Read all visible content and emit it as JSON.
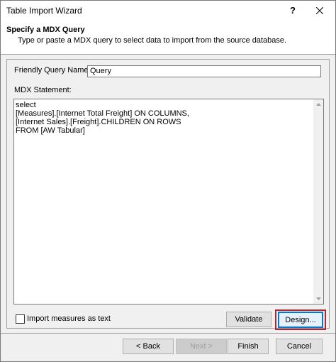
{
  "window": {
    "title": "Table Import Wizard",
    "help_label": "?"
  },
  "header": {
    "step_title": "Specify a MDX Query",
    "step_description": "Type or paste a MDX query to select data to import from the source database."
  },
  "form": {
    "friendly_query_name_label": "Friendly Query Name:",
    "friendly_query_name_value": "Query",
    "mdx_statement_label": "MDX Statement:",
    "mdx_statement_value": "select\n[Measures].[Internet Total Freight] ON COLUMNS,\n[Internet Sales].[Freight].CHILDREN ON ROWS\nFROM [AW Tabular]",
    "import_measures_as_text_label": "Import measures as text",
    "import_measures_as_text_checked": false,
    "validate_label": "Validate",
    "design_label": "Design..."
  },
  "footer": {
    "back_label": "< Back",
    "next_label": "Next >",
    "finish_label": "Finish",
    "cancel_label": "Cancel"
  },
  "colors": {
    "highlight_border": "#b3262e",
    "focus_border": "#0078d7"
  },
  "icons": {
    "close": "close-icon",
    "scroll_up": "scroll-up-icon",
    "scroll_down": "scroll-down-icon"
  }
}
